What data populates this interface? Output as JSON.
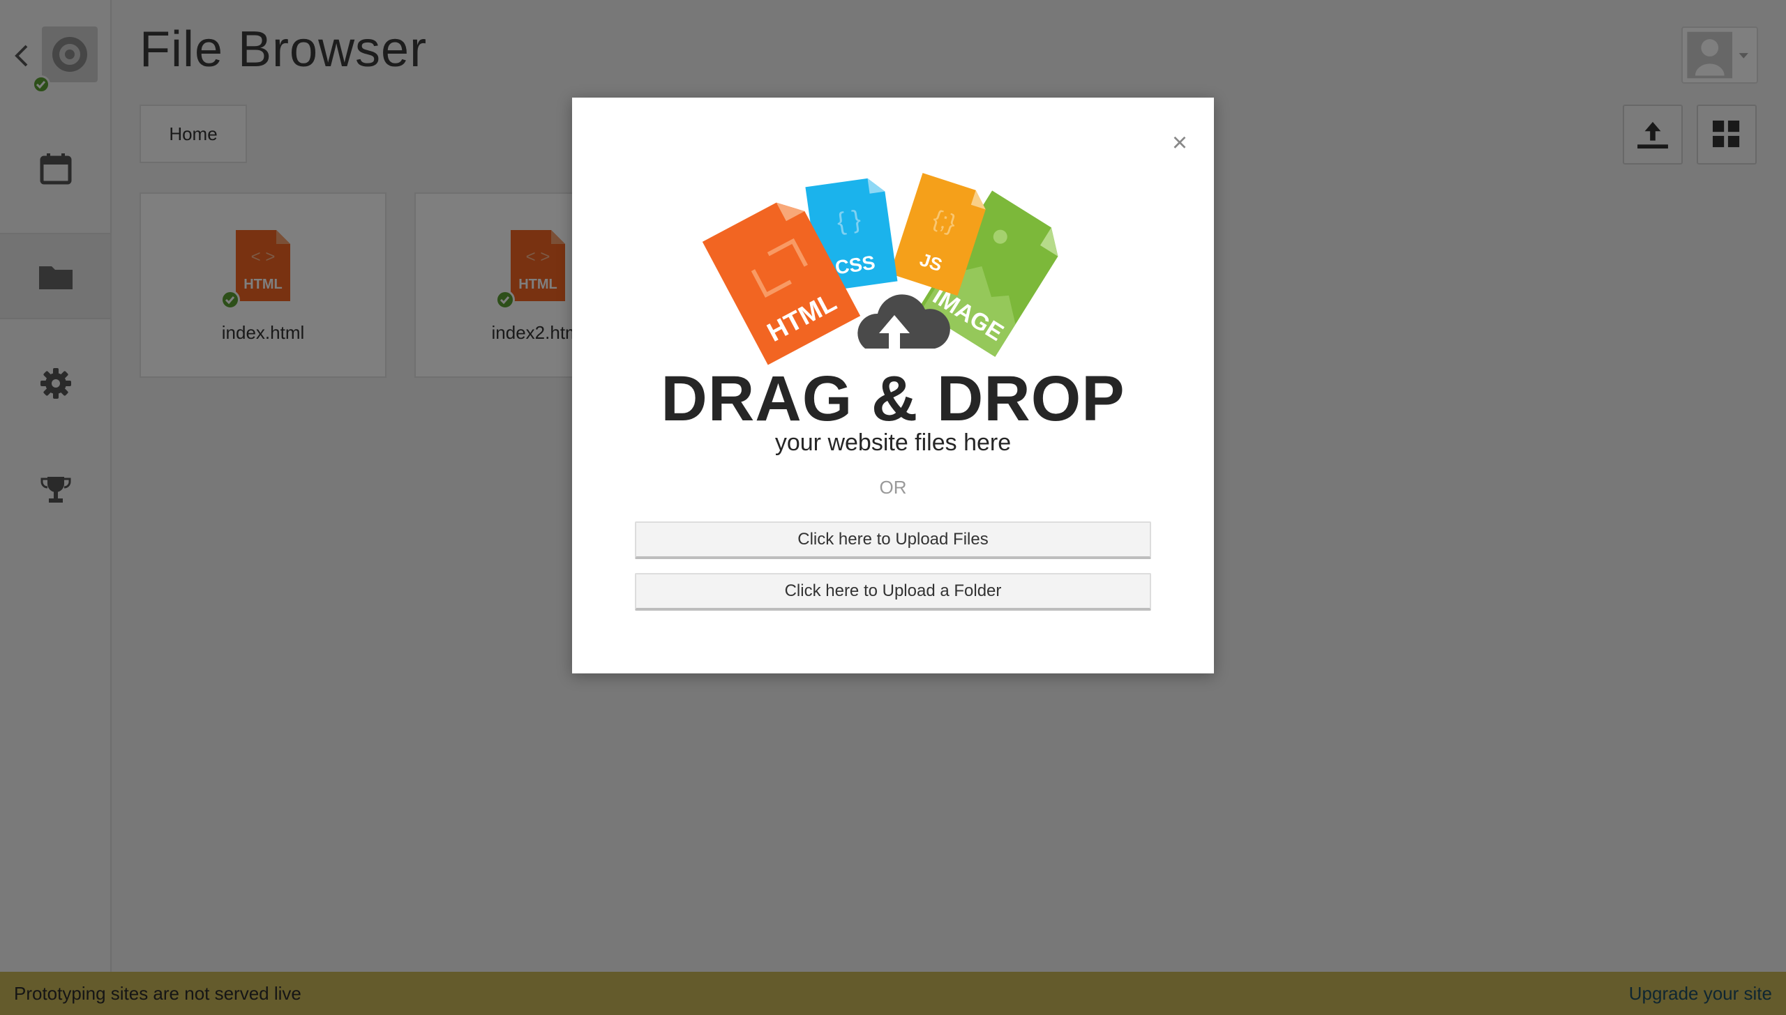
{
  "app": {
    "title": "File Browser"
  },
  "breadcrumb": {
    "home_label": "Home"
  },
  "files": [
    {
      "name": "index.html",
      "badge": "HTML"
    },
    {
      "name": "index2.html",
      "badge": "HTML"
    }
  ],
  "modal": {
    "heading": "DRAG & DROP",
    "subheading": "your website files here",
    "or_label": "OR",
    "upload_files_label": "Click here to Upload Files",
    "upload_folder_label": "Click here to Upload a Folder",
    "close_label": "×",
    "art_labels": {
      "html": "HTML",
      "css": "CSS",
      "js": "JS",
      "image": "IMAGE"
    }
  },
  "footer": {
    "status_text": "Prototyping sites are not served live",
    "upgrade_link": "Upgrade your site"
  },
  "colors": {
    "html_orange": "#f26522",
    "css_blue": "#1bb3ec",
    "js_orange": "#f5a01a",
    "image_green": "#7cb83a",
    "check_green": "#5a9e32",
    "footer_bar": "#c9b659"
  }
}
